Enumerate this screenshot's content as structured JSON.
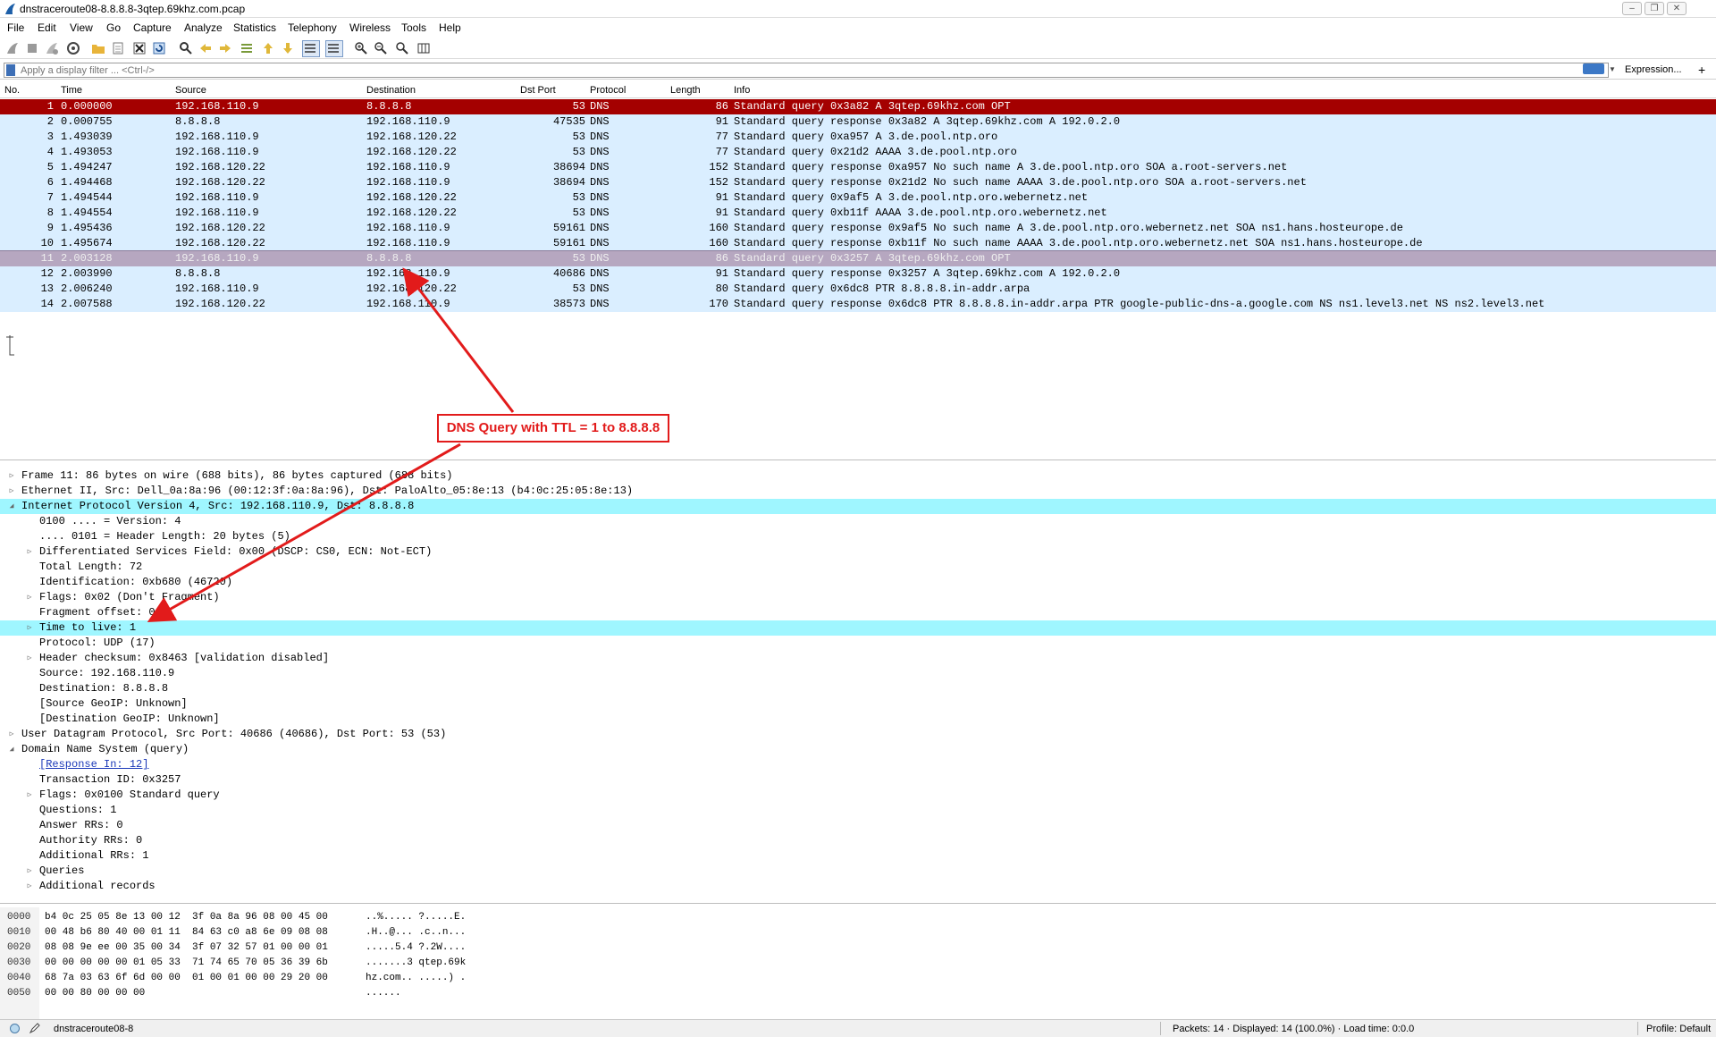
{
  "window": {
    "title": "dnstraceroute08-8.8.8.8-3qtep.69khz.com.pcap",
    "controls": [
      "–",
      "❐",
      "✕"
    ]
  },
  "menu": [
    "File",
    "Edit",
    "View",
    "Go",
    "Capture",
    "Analyze",
    "Statistics",
    "Telephony",
    "Wireless",
    "Tools",
    "Help"
  ],
  "filter": {
    "placeholder": "Apply a display filter ... <Ctrl-/>",
    "expression_label": "Expression...",
    "plus_label": "+"
  },
  "packet_list": {
    "columns": [
      "No.",
      "Time",
      "Source",
      "Destination",
      "Dst Port",
      "Protocol",
      "Length",
      "Info"
    ],
    "rows": [
      {
        "no": "1",
        "time": "0.000000",
        "src": "192.168.110.9",
        "dst": "8.8.8.8",
        "dport": "53",
        "proto": "DNS",
        "len": "86",
        "info": "Standard query 0x3a82 A 3qtep.69khz.com OPT"
      },
      {
        "no": "2",
        "time": "0.000755",
        "src": "8.8.8.8",
        "dst": "192.168.110.9",
        "dport": "47535",
        "proto": "DNS",
        "len": "91",
        "info": "Standard query response 0x3a82 A 3qtep.69khz.com A 192.0.2.0"
      },
      {
        "no": "3",
        "time": "1.493039",
        "src": "192.168.110.9",
        "dst": "192.168.120.22",
        "dport": "53",
        "proto": "DNS",
        "len": "77",
        "info": "Standard query 0xa957 A 3.de.pool.ntp.oro"
      },
      {
        "no": "4",
        "time": "1.493053",
        "src": "192.168.110.9",
        "dst": "192.168.120.22",
        "dport": "53",
        "proto": "DNS",
        "len": "77",
        "info": "Standard query 0x21d2 AAAA 3.de.pool.ntp.oro"
      },
      {
        "no": "5",
        "time": "1.494247",
        "src": "192.168.120.22",
        "dst": "192.168.110.9",
        "dport": "38694",
        "proto": "DNS",
        "len": "152",
        "info": "Standard query response 0xa957 No such name A 3.de.pool.ntp.oro SOA a.root-servers.net"
      },
      {
        "no": "6",
        "time": "1.494468",
        "src": "192.168.120.22",
        "dst": "192.168.110.9",
        "dport": "38694",
        "proto": "DNS",
        "len": "152",
        "info": "Standard query response 0x21d2 No such name AAAA 3.de.pool.ntp.oro SOA a.root-servers.net"
      },
      {
        "no": "7",
        "time": "1.494544",
        "src": "192.168.110.9",
        "dst": "192.168.120.22",
        "dport": "53",
        "proto": "DNS",
        "len": "91",
        "info": "Standard query 0x9af5 A 3.de.pool.ntp.oro.webernetz.net"
      },
      {
        "no": "8",
        "time": "1.494554",
        "src": "192.168.110.9",
        "dst": "192.168.120.22",
        "dport": "53",
        "proto": "DNS",
        "len": "91",
        "info": "Standard query 0xb11f AAAA 3.de.pool.ntp.oro.webernetz.net"
      },
      {
        "no": "9",
        "time": "1.495436",
        "src": "192.168.120.22",
        "dst": "192.168.110.9",
        "dport": "59161",
        "proto": "DNS",
        "len": "160",
        "info": "Standard query response 0x9af5 No such name A 3.de.pool.ntp.oro.webernetz.net SOA ns1.hans.hosteurope.de"
      },
      {
        "no": "10",
        "time": "1.495674",
        "src": "192.168.120.22",
        "dst": "192.168.110.9",
        "dport": "59161",
        "proto": "DNS",
        "len": "160",
        "info": "Standard query response 0xb11f No such name AAAA 3.de.pool.ntp.oro.webernetz.net SOA ns1.hans.hosteurope.de"
      },
      {
        "no": "11",
        "time": "2.003128",
        "src": "192.168.110.9",
        "dst": "8.8.8.8",
        "dport": "53",
        "proto": "DNS",
        "len": "86",
        "info": "Standard query 0x3257 A 3qtep.69khz.com OPT"
      },
      {
        "no": "12",
        "time": "2.003990",
        "src": "8.8.8.8",
        "dst": "192.168.110.9",
        "dport": "40686",
        "proto": "DNS",
        "len": "91",
        "info": "Standard query response 0x3257 A 3qtep.69khz.com A 192.0.2.0"
      },
      {
        "no": "13",
        "time": "2.006240",
        "src": "192.168.110.9",
        "dst": "192.168.120.22",
        "dport": "53",
        "proto": "DNS",
        "len": "80",
        "info": "Standard query 0x6dc8 PTR 8.8.8.8.in-addr.arpa"
      },
      {
        "no": "14",
        "time": "2.007588",
        "src": "192.168.120.22",
        "dst": "192.168.110.9",
        "dport": "38573",
        "proto": "DNS",
        "len": "170",
        "info": "Standard query response 0x6dc8 PTR 8.8.8.8.in-addr.arpa PTR google-public-dns-a.google.com NS ns1.level3.net NS ns2.level3.net"
      }
    ]
  },
  "annotation": {
    "label": "DNS Query with TTL = 1 to 8.8.8.8",
    "color": "#e21b1b"
  },
  "details": [
    {
      "level": 0,
      "toggle": "collapsed",
      "text": "Frame 11: 86 bytes on wire (688 bits), 86 bytes captured (688 bits)"
    },
    {
      "level": 0,
      "toggle": "collapsed",
      "text": "Ethernet II, Src: Dell_0a:8a:96 (00:12:3f:0a:8a:96), Dst: PaloAlto_05:8e:13 (b4:0c:25:05:8e:13)"
    },
    {
      "level": 0,
      "toggle": "expanded",
      "text": "Internet Protocol Version 4, Src: 192.168.110.9, Dst: 8.8.8.8",
      "highlight": true
    },
    {
      "level": 1,
      "toggle": "none",
      "text": "0100 .... = Version: 4"
    },
    {
      "level": 1,
      "toggle": "none",
      "text": ".... 0101 = Header Length: 20 bytes (5)"
    },
    {
      "level": 1,
      "toggle": "collapsed",
      "text": "Differentiated Services Field: 0x00 (DSCP: CS0, ECN: Not-ECT)"
    },
    {
      "level": 1,
      "toggle": "none",
      "text": "Total Length: 72"
    },
    {
      "level": 1,
      "toggle": "none",
      "text": "Identification: 0xb680 (46720)"
    },
    {
      "level": 1,
      "toggle": "collapsed",
      "text": "Flags: 0x02 (Don't Fragment)"
    },
    {
      "level": 1,
      "toggle": "none",
      "text": "Fragment offset: 0"
    },
    {
      "level": 1,
      "toggle": "collapsed",
      "text": "Time to live: 1",
      "highlight": true
    },
    {
      "level": 1,
      "toggle": "none",
      "text": "Protocol: UDP (17)"
    },
    {
      "level": 1,
      "toggle": "collapsed",
      "text": "Header checksum: 0x8463 [validation disabled]"
    },
    {
      "level": 1,
      "toggle": "none",
      "text": "Source: 192.168.110.9"
    },
    {
      "level": 1,
      "toggle": "none",
      "text": "Destination: 8.8.8.8"
    },
    {
      "level": 1,
      "toggle": "none",
      "text": "[Source GeoIP: Unknown]"
    },
    {
      "level": 1,
      "toggle": "none",
      "text": "[Destination GeoIP: Unknown]"
    },
    {
      "level": 0,
      "toggle": "collapsed",
      "text": "User Datagram Protocol, Src Port: 40686 (40686), Dst Port: 53 (53)"
    },
    {
      "level": 0,
      "toggle": "expanded",
      "text": "Domain Name System (query)"
    },
    {
      "level": 1,
      "toggle": "none",
      "text": "[Response In: 12]",
      "link": true
    },
    {
      "level": 1,
      "toggle": "none",
      "text": "Transaction ID: 0x3257"
    },
    {
      "level": 1,
      "toggle": "collapsed",
      "text": "Flags: 0x0100 Standard query"
    },
    {
      "level": 1,
      "toggle": "none",
      "text": "Questions: 1"
    },
    {
      "level": 1,
      "toggle": "none",
      "text": "Answer RRs: 0"
    },
    {
      "level": 1,
      "toggle": "none",
      "text": "Authority RRs: 0"
    },
    {
      "level": 1,
      "toggle": "none",
      "text": "Additional RRs: 1"
    },
    {
      "level": 1,
      "toggle": "collapsed",
      "text": "Queries"
    },
    {
      "level": 1,
      "toggle": "collapsed",
      "text": "Additional records"
    }
  ],
  "bytes": [
    {
      "off": "0000",
      "hex": "b4 0c 25 05 8e 13 00 12  3f 0a 8a 96 08 00 45 00",
      "ascii": "..%..... ?.....E."
    },
    {
      "off": "0010",
      "hex": "00 48 b6 80 40 00 01 11  84 63 c0 a8 6e 09 08 08",
      "ascii": ".H..@... .c..n..."
    },
    {
      "off": "0020",
      "hex": "08 08 9e ee 00 35 00 34  3f 07 32 57 01 00 00 01",
      "ascii": ".....5.4 ?.2W...."
    },
    {
      "off": "0030",
      "hex": "00 00 00 00 00 01 05 33  71 74 65 70 05 36 39 6b",
      "ascii": ".......3 qtep.69k"
    },
    {
      "off": "0040",
      "hex": "68 7a 03 63 6f 6d 00 00  01 00 01 00 00 29 20 00",
      "ascii": "hz.com.. .....) ."
    },
    {
      "off": "0050",
      "hex": "00 00 80 00 00 00",
      "ascii": "......"
    }
  ],
  "status": {
    "file": "dnstraceroute08-8",
    "packets": "Packets: 14 · Displayed: 14 (100.0%) · Load time: 0:0.0",
    "profile": "Profile: Default"
  }
}
